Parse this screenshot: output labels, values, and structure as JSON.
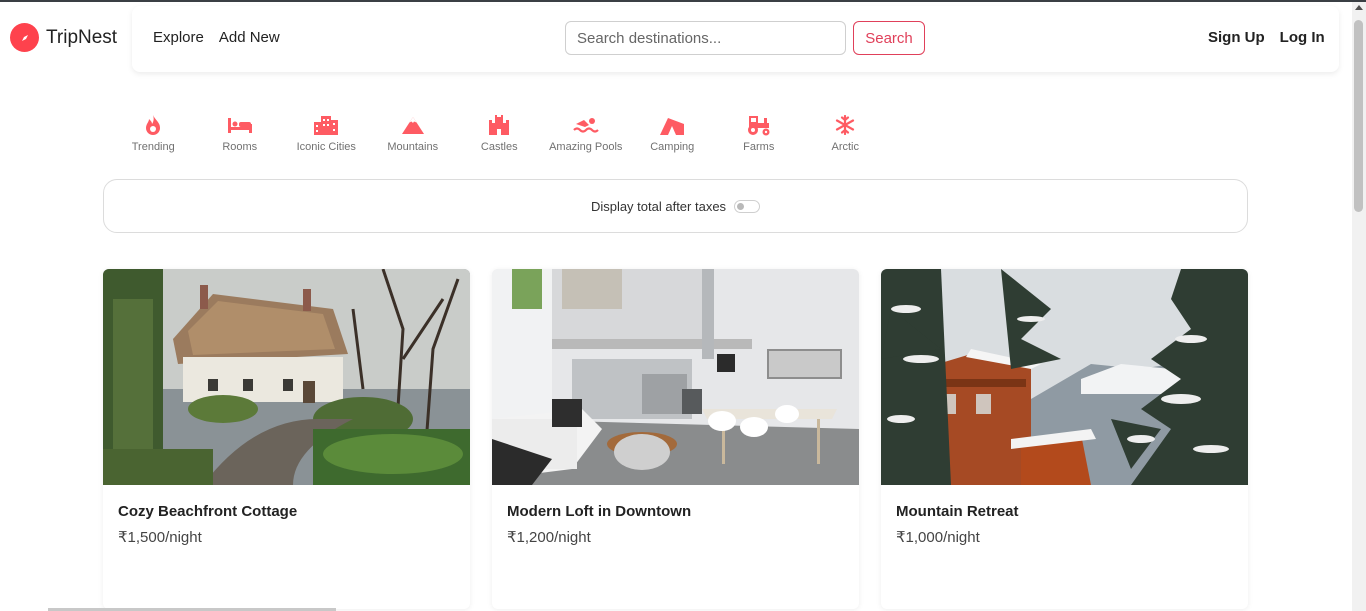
{
  "brand": {
    "name": "TripNest",
    "icon": "compass-icon"
  },
  "nav": {
    "explore": "Explore",
    "add_new": "Add New"
  },
  "search": {
    "placeholder": "Search destinations...",
    "button": "Search"
  },
  "auth": {
    "sign_up": "Sign Up",
    "log_in": "Log In"
  },
  "filters": [
    {
      "label": "Trending",
      "icon": "fire-icon"
    },
    {
      "label": "Rooms",
      "icon": "bed-icon"
    },
    {
      "label": "Iconic Cities",
      "icon": "city-icon"
    },
    {
      "label": "Mountains",
      "icon": "mountain-icon"
    },
    {
      "label": "Castles",
      "icon": "castle-icon"
    },
    {
      "label": "Amazing Pools",
      "icon": "swimmer-icon"
    },
    {
      "label": "Camping",
      "icon": "tent-icon"
    },
    {
      "label": "Farms",
      "icon": "tractor-icon"
    },
    {
      "label": "Arctic",
      "icon": "snowflake-icon"
    }
  ],
  "tax_toggle": {
    "label": "Display total after taxes",
    "enabled": false
  },
  "listings": [
    {
      "title": "Cozy Beachfront Cottage",
      "price": "₹1,500/night"
    },
    {
      "title": "Modern Loft in Downtown",
      "price": "₹1,200/night"
    },
    {
      "title": "Mountain Retreat",
      "price": "₹1,000/night"
    }
  ],
  "colors": {
    "brand": "#fe424d",
    "accent": "#e0405a",
    "filter_icon": "#fe5b63"
  }
}
